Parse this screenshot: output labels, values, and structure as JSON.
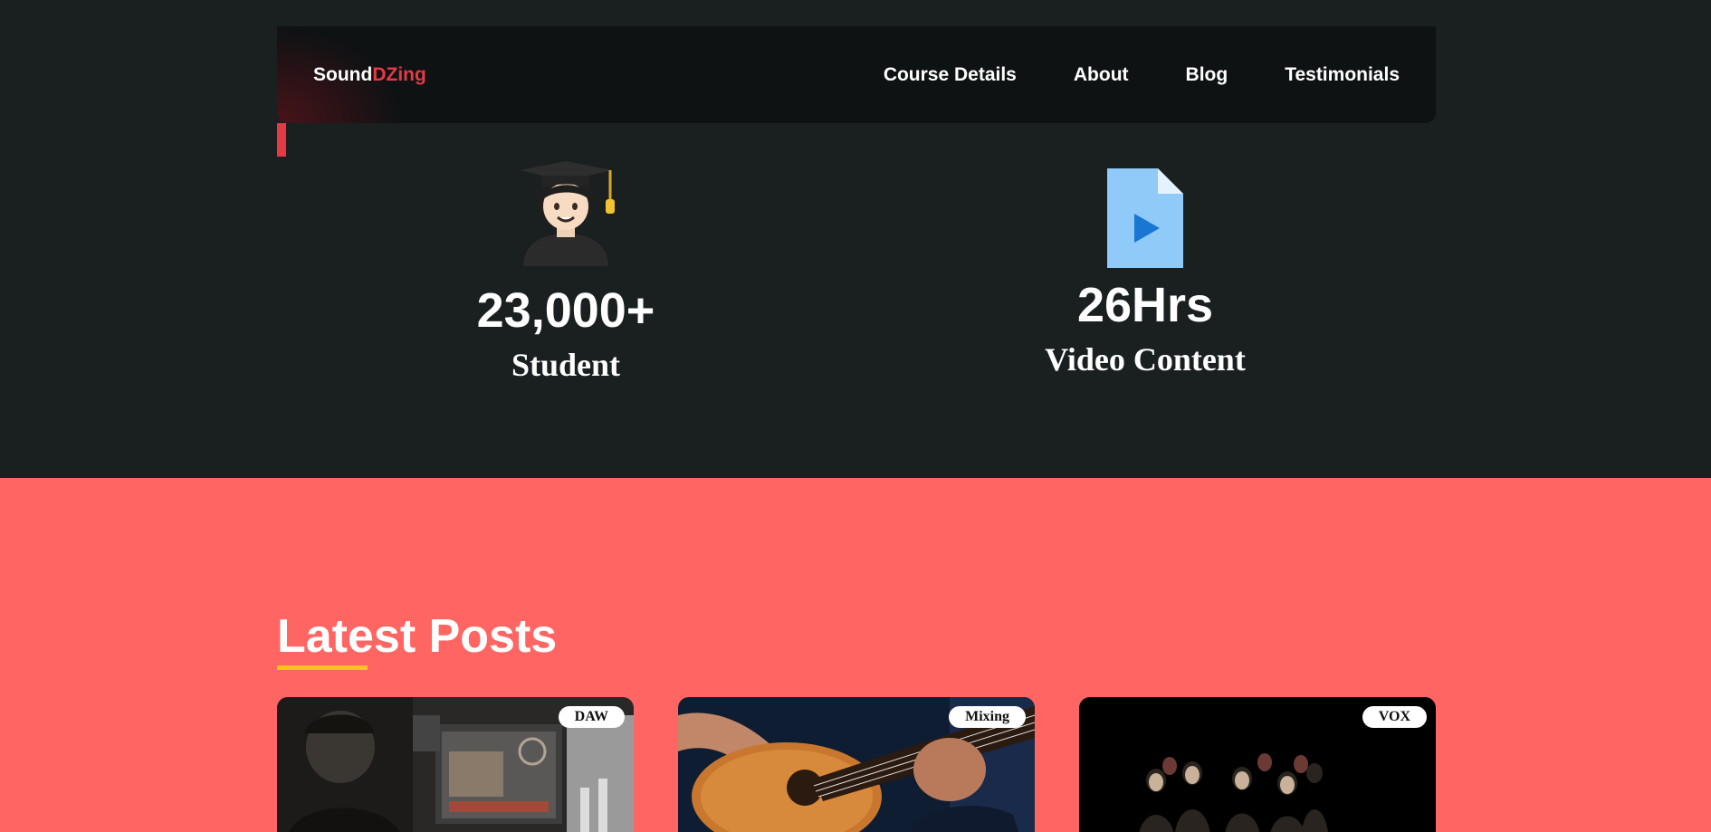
{
  "brand": {
    "part1": "Sound",
    "part2": "DZing",
    "accent_color": "#e63946"
  },
  "nav": {
    "items": [
      {
        "label": "Course Details"
      },
      {
        "label": "About"
      },
      {
        "label": "Blog"
      },
      {
        "label": "Testimonials"
      }
    ]
  },
  "stats": {
    "students": {
      "icon": "student-graduate-icon",
      "number": "23,000+",
      "label": "Student"
    },
    "video": {
      "icon": "video-file-icon",
      "number": "26Hrs",
      "label": "Video Content"
    }
  },
  "posts": {
    "title": "Latest Posts",
    "background": "#ff6562",
    "underline_color": "#ffc21a",
    "cards": [
      {
        "tag": "DAW"
      },
      {
        "tag": "Mixing"
      },
      {
        "tag": "VOX"
      }
    ]
  }
}
